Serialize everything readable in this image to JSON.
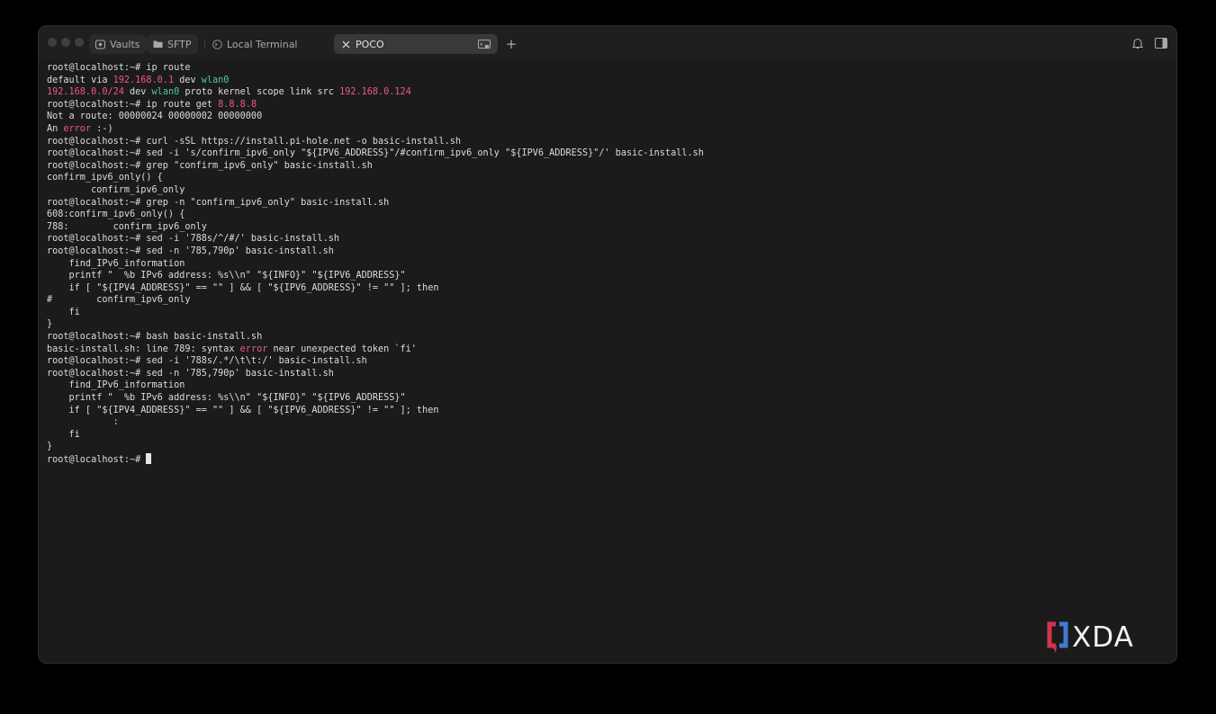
{
  "window": {
    "tabs": [
      {
        "label": "Vaults",
        "icon": "vault-icon"
      },
      {
        "label": "SFTP",
        "icon": "folder-icon"
      },
      {
        "label": "Local Terminal",
        "icon": "terminal-icon"
      },
      {
        "label": "POCO",
        "icon": "close-icon",
        "active": true
      }
    ],
    "new_tab": "+"
  },
  "colors": {
    "background": "#1b1b1c",
    "text": "#dcdcdc",
    "ip_highlight": "#ef5a7c",
    "interface_highlight": "#57c2a9",
    "error_highlight": "#ef5a7c"
  },
  "terminal": {
    "lines": [
      [
        {
          "t": "root@localhost:~# ip route"
        }
      ],
      [
        {
          "t": "default via "
        },
        {
          "t": "192.168.0.1",
          "c": "ip"
        },
        {
          "t": " dev "
        },
        {
          "t": "wlan0",
          "c": "dev"
        }
      ],
      [
        {
          "t": "192.168.0.0/24",
          "c": "ip"
        },
        {
          "t": " dev "
        },
        {
          "t": "wlan0",
          "c": "dev"
        },
        {
          "t": " proto kernel scope link src "
        },
        {
          "t": "192.168.0.124",
          "c": "ip"
        }
      ],
      [
        {
          "t": "root@localhost:~# ip route get "
        },
        {
          "t": "8.8.8.8",
          "c": "ip"
        }
      ],
      [
        {
          "t": "Not a route: 00000024 00000002 00000000"
        }
      ],
      [
        {
          "t": "An "
        },
        {
          "t": "error",
          "c": "err"
        },
        {
          "t": " :-)"
        }
      ],
      [
        {
          "t": "root@localhost:~# curl -sSL https://install.pi-hole.net -o basic-install.sh"
        }
      ],
      [
        {
          "t": "root@localhost:~# sed -i 's/confirm_ipv6_only \"${IPV6_ADDRESS}\"/#confirm_ipv6_only \"${IPV6_ADDRESS}\"/' basic-install.sh"
        }
      ],
      [
        {
          "t": "root@localhost:~# grep \"confirm_ipv6_only\" basic-install.sh"
        }
      ],
      [
        {
          "t": "confirm_ipv6_only() {"
        }
      ],
      [
        {
          "t": "        confirm_ipv6_only"
        }
      ],
      [
        {
          "t": "root@localhost:~# grep -n \"confirm_ipv6_only\" basic-install.sh"
        }
      ],
      [
        {
          "t": "608:confirm_ipv6_only() {"
        }
      ],
      [
        {
          "t": "788:        confirm_ipv6_only"
        }
      ],
      [
        {
          "t": "root@localhost:~# sed -i '788s/^/#/' basic-install.sh"
        }
      ],
      [
        {
          "t": "root@localhost:~# sed -n '785,790p' basic-install.sh"
        }
      ],
      [
        {
          "t": "    find_IPv6_information"
        }
      ],
      [
        {
          "t": "    printf \"  %b IPv6 address: %s\\\\n\" \"${INFO}\" \"${IPV6_ADDRESS}\""
        }
      ],
      [
        {
          "t": "    if [ \"${IPV4_ADDRESS}\" == \"\" ] && [ \"${IPV6_ADDRESS}\" != \"\" ]; then"
        }
      ],
      [
        {
          "t": "#        confirm_ipv6_only"
        }
      ],
      [
        {
          "t": "    fi"
        }
      ],
      [
        {
          "t": "}"
        }
      ],
      [
        {
          "t": "root@localhost:~# bash basic-install.sh"
        }
      ],
      [
        {
          "t": "basic-install.sh: line 789: syntax "
        },
        {
          "t": "error",
          "c": "err"
        },
        {
          "t": " near unexpected token `fi'"
        }
      ],
      [
        {
          "t": "root@localhost:~# sed -i '788s/.*/\\t\\t:/' basic-install.sh"
        }
      ],
      [
        {
          "t": "root@localhost:~# sed -n '785,790p' basic-install.sh"
        }
      ],
      [
        {
          "t": "    find_IPv6_information"
        }
      ],
      [
        {
          "t": "    printf \"  %b IPv6 address: %s\\\\n\" \"${INFO}\" \"${IPV6_ADDRESS}\""
        }
      ],
      [
        {
          "t": "    if [ \"${IPV4_ADDRESS}\" == \"\" ] && [ \"${IPV6_ADDRESS}\" != \"\" ]; then"
        }
      ],
      [
        {
          "t": "            :"
        }
      ],
      [
        {
          "t": "    fi"
        }
      ],
      [
        {
          "t": "}"
        }
      ]
    ],
    "prompt": "root@localhost:~# "
  },
  "watermark": {
    "text": "XDA"
  }
}
